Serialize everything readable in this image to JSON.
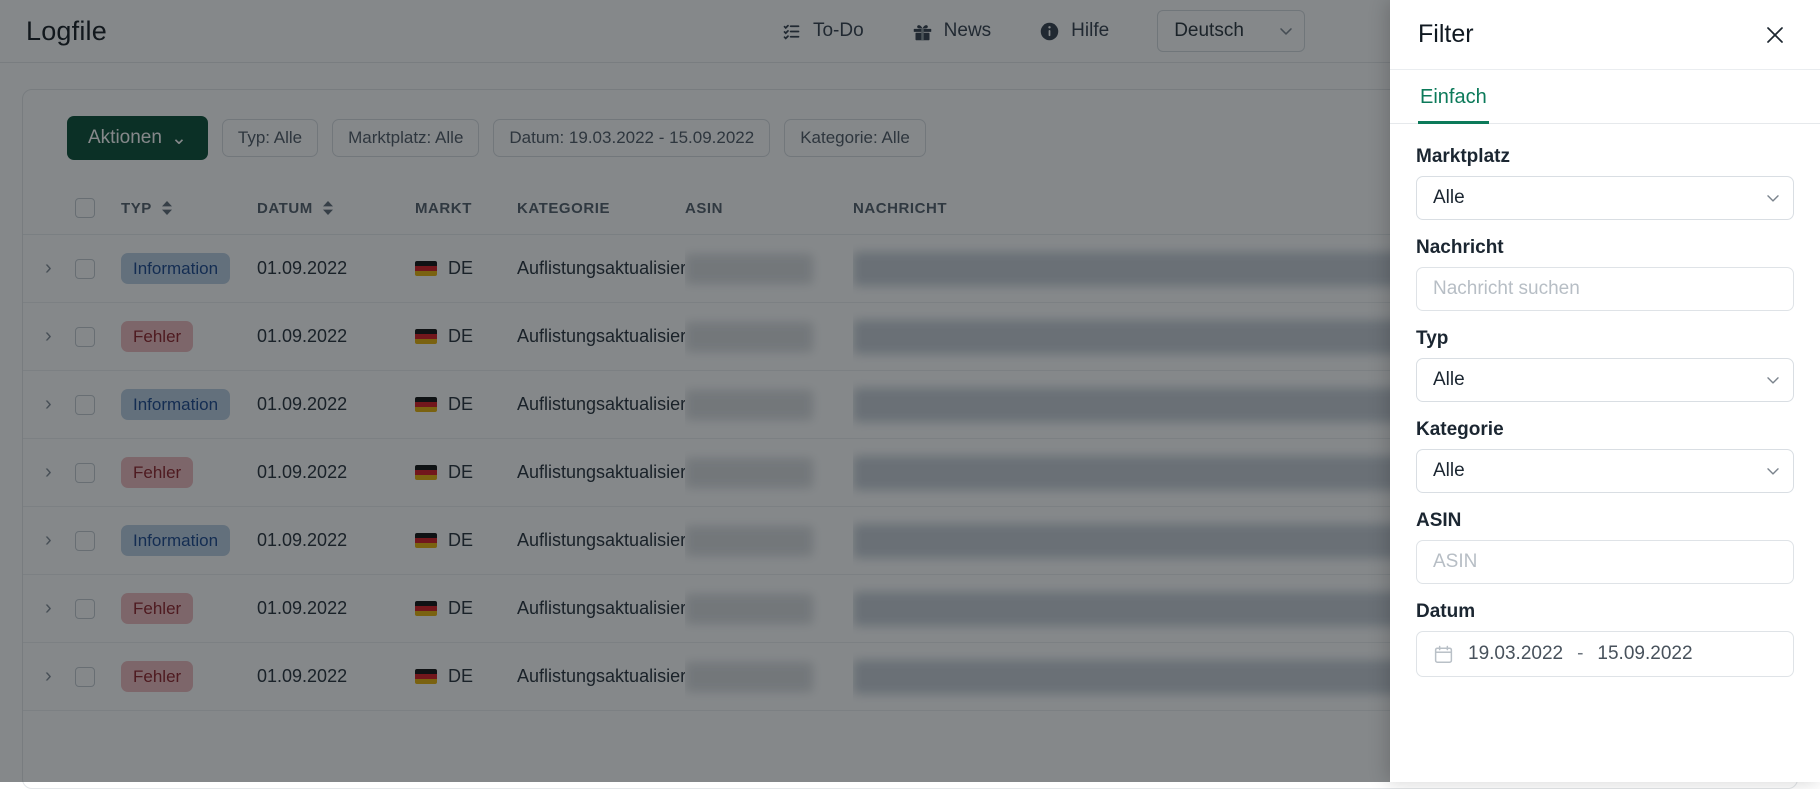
{
  "app": {
    "brand": "Logfile"
  },
  "topnav": {
    "items": [
      {
        "label": "To-Do",
        "icon": "checklist-icon"
      },
      {
        "label": "News",
        "icon": "gift-icon"
      },
      {
        "label": "Hilfe",
        "icon": "info-icon"
      }
    ],
    "language": {
      "value": "Deutsch",
      "icon": "chevron-down-icon"
    }
  },
  "toolbar": {
    "actions_label": "Aktionen",
    "actions_caret": "⌄",
    "chips": [
      {
        "label": "Typ: Alle"
      },
      {
        "label": "Marktplatz: Alle"
      },
      {
        "label": "Datum: 19.03.2022 - 15.09.2022"
      },
      {
        "label": "Kategorie: Alle"
      }
    ]
  },
  "table": {
    "columns": [
      {
        "key": "expand",
        "label": "",
        "sortable": false
      },
      {
        "key": "select",
        "label": "",
        "sortable": false
      },
      {
        "key": "typ",
        "label": "TYP",
        "sortable": true
      },
      {
        "key": "datum",
        "label": "DATUM",
        "sortable": true
      },
      {
        "key": "markt",
        "label": "MARKT",
        "sortable": false
      },
      {
        "key": "kategorie",
        "label": "KATEGORIE",
        "sortable": false
      },
      {
        "key": "asin",
        "label": "ASIN",
        "sortable": false
      },
      {
        "key": "nachricht",
        "label": "NACHRICHT",
        "sortable": false
      }
    ],
    "rows": [
      {
        "typ": "Information",
        "typ_kind": "info",
        "datum": "01.09.2022",
        "markt": "DE",
        "markt_flag": "flag-de-icon",
        "kategorie": "Auflistungsaktualisierung",
        "asin": "",
        "nachricht": ""
      },
      {
        "typ": "Fehler",
        "typ_kind": "error",
        "datum": "01.09.2022",
        "markt": "DE",
        "markt_flag": "flag-de-icon",
        "kategorie": "Auflistungsaktualisierung",
        "asin": "",
        "nachricht": ""
      },
      {
        "typ": "Information",
        "typ_kind": "info",
        "datum": "01.09.2022",
        "markt": "DE",
        "markt_flag": "flag-de-icon",
        "kategorie": "Auflistungsaktualisierung",
        "asin": "",
        "nachricht": ""
      },
      {
        "typ": "Fehler",
        "typ_kind": "error",
        "datum": "01.09.2022",
        "markt": "DE",
        "markt_flag": "flag-de-icon",
        "kategorie": "Auflistungsaktualisierung",
        "asin": "",
        "nachricht": ""
      },
      {
        "typ": "Information",
        "typ_kind": "info",
        "datum": "01.09.2022",
        "markt": "DE",
        "markt_flag": "flag-de-icon",
        "kategorie": "Auflistungsaktualisierung",
        "asin": "",
        "nachricht": ""
      },
      {
        "typ": "Fehler",
        "typ_kind": "error",
        "datum": "01.09.2022",
        "markt": "DE",
        "markt_flag": "flag-de-icon",
        "kategorie": "Auflistungsaktualisierung",
        "asin": "",
        "nachricht": ""
      },
      {
        "typ": "Fehler",
        "typ_kind": "error",
        "datum": "01.09.2022",
        "markt": "DE",
        "markt_flag": "flag-de-icon",
        "kategorie": "Auflistungsaktualisierung",
        "asin": "",
        "nachricht": ""
      }
    ]
  },
  "filter_drawer": {
    "title": "Filter",
    "close_icon": "close-icon",
    "tabs": [
      {
        "label": "Einfach",
        "active": true
      }
    ],
    "fields": {
      "marktplatz": {
        "label": "Marktplatz",
        "value": "Alle",
        "icon": "chevron-down-icon"
      },
      "nachricht": {
        "label": "Nachricht",
        "value": "",
        "placeholder": "Nachricht suchen"
      },
      "typ": {
        "label": "Typ",
        "value": "Alle",
        "icon": "chevron-down-icon"
      },
      "kategorie": {
        "label": "Kategorie",
        "value": "Alle",
        "icon": "chevron-down-icon"
      },
      "asin": {
        "label": "ASIN",
        "value": "",
        "placeholder": "ASIN"
      },
      "datum": {
        "label": "Datum",
        "icon": "calendar-icon",
        "start": "19.03.2022",
        "separator": "-",
        "end": "15.09.2022"
      }
    }
  },
  "colors": {
    "accent_green": "#0c7a5a",
    "button_green": "#00472e",
    "badge_info_bg": "#b9cde2",
    "badge_info_fg": "#13418a",
    "badge_error_bg": "#efb9bc",
    "badge_error_fg": "#8c1b22"
  }
}
